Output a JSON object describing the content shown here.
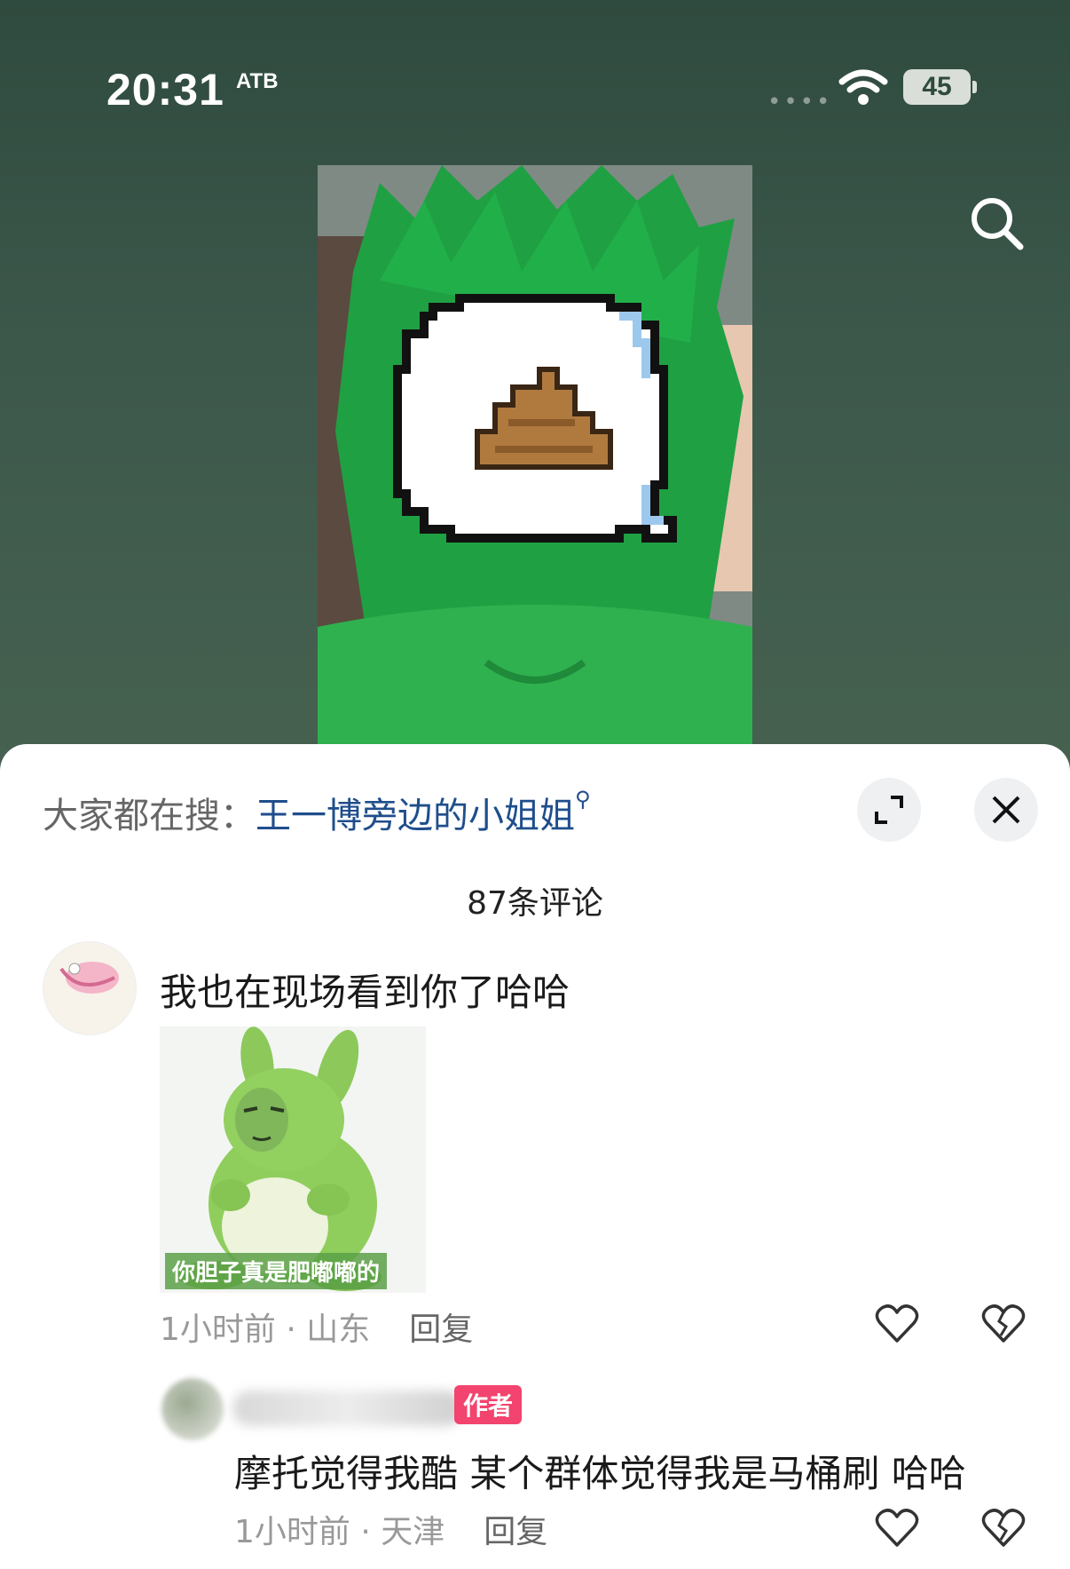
{
  "status_bar": {
    "time": "20:31",
    "extra": "ATB",
    "battery": "45"
  },
  "top_bar": {
    "search_icon": "search-icon"
  },
  "sheet": {
    "hot_search_prefix": "大家都在搜：",
    "hot_search_term": "王一博旁边的小姐姐",
    "comment_count": "87条评论"
  },
  "comments": [
    {
      "text": "我也在现场看到你了哈哈",
      "sticker_caption": "你胆子真是肥嘟嘟的",
      "time": "1小时前",
      "location": "山东",
      "reply_label": "回复"
    },
    {
      "badge": "作者",
      "text": "摩托觉得我酷 某个群体觉得我是马桶刷 哈哈",
      "time": "1小时前",
      "location": "天津",
      "reply_label": "回复"
    }
  ],
  "colors": {
    "link": "#1f4e8c",
    "author_badge": "#f2446e",
    "meta": "#999999"
  }
}
